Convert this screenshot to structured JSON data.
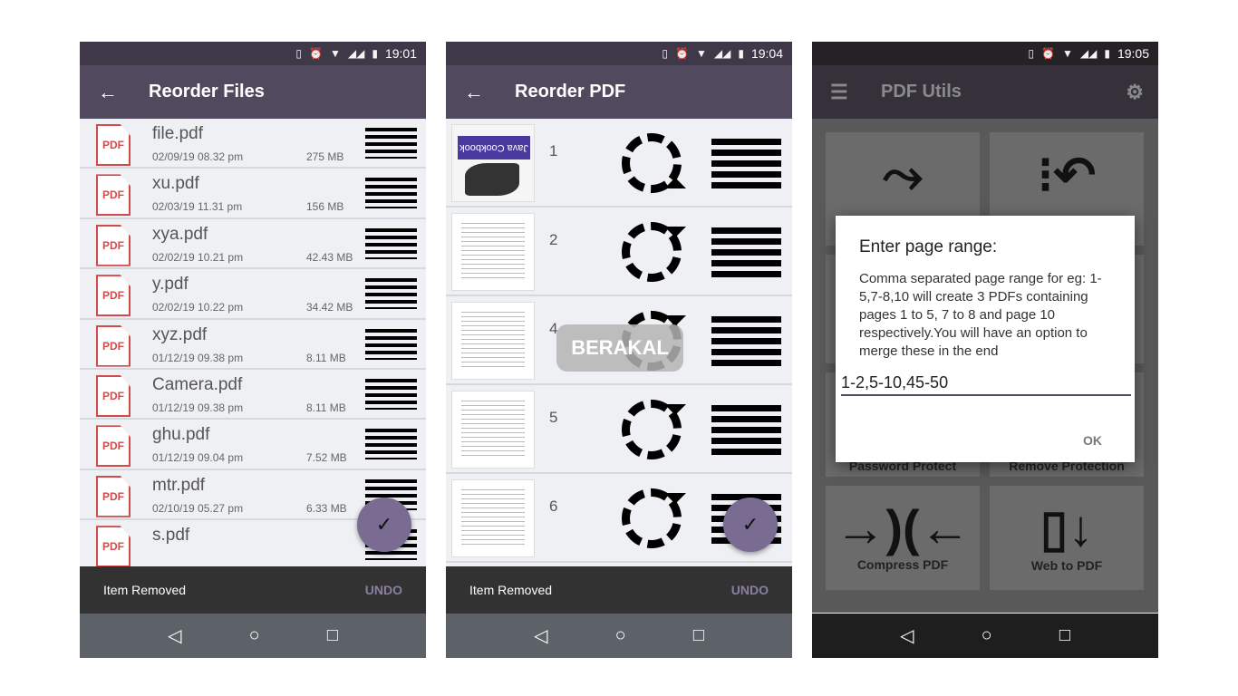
{
  "status_icons": [
    "vibrate-icon",
    "alarm-icon",
    "wifi-icon",
    "4g-signal-icon",
    "signal-icon",
    "battery-icon"
  ],
  "screens": [
    {
      "time": "19:01",
      "title": "Reorder Files",
      "snackbar": {
        "message": "Item Removed",
        "action": "UNDO"
      },
      "files": [
        {
          "name": "file.pdf",
          "date": "02/09/19 08.32 pm",
          "size": "275 MB"
        },
        {
          "name": "xu.pdf",
          "date": "02/03/19 11.31 pm",
          "size": "156 MB"
        },
        {
          "name": "xya.pdf",
          "date": "02/02/19 10.21 pm",
          "size": "42.43 MB"
        },
        {
          "name": "y.pdf",
          "date": "02/02/19 10.22 pm",
          "size": "34.42 MB"
        },
        {
          "name": "xyz.pdf",
          "date": "01/12/19 09.38 pm",
          "size": "8.11 MB"
        },
        {
          "name": "Camera.pdf",
          "date": "01/12/19 09.38 pm",
          "size": "8.11 MB"
        },
        {
          "name": "ghu.pdf",
          "date": "01/12/19 09.04 pm",
          "size": "7.52 MB"
        },
        {
          "name": "mtr.pdf",
          "date": "02/10/19 05.27 pm",
          "size": "6.33 MB"
        },
        {
          "name": "s.pdf",
          "date": "",
          "size": ""
        }
      ]
    },
    {
      "time": "19:04",
      "title": "Reorder PDF",
      "snackbar": {
        "message": "Item Removed",
        "action": "UNDO"
      },
      "cover_title": "Java Cookbook",
      "pages": [
        "1",
        "2",
        "4",
        "5",
        "6"
      ],
      "watermark": "BERAKAL"
    },
    {
      "time": "19:05",
      "title": "PDF Utils",
      "tiles": [
        {
          "label": "",
          "icon": "merge-icon"
        },
        {
          "label": "",
          "icon": "reorder-icon"
        },
        {
          "label": "Password Protect",
          "icon": ""
        },
        {
          "label": "Remove Protection",
          "icon": ""
        },
        {
          "label": "Compress PDF",
          "icon": "compress-icon"
        },
        {
          "label": "Web to PDF",
          "icon": "web-to-pdf-icon"
        }
      ],
      "dialog": {
        "title": "Enter page range:",
        "message": "Comma separated page range for eg: 1-5,7-8,10 will create 3 PDFs containing pages 1 to 5, 7 to 8 and page 10 respectively.You will have an option to merge these in the end",
        "input_value": "1-2,5-10,45-50",
        "ok": "OK"
      }
    }
  ],
  "colors": {
    "toolbar": "#514a5e",
    "fab": "#7a6b92",
    "pdf_icon": "#d14b4b"
  }
}
